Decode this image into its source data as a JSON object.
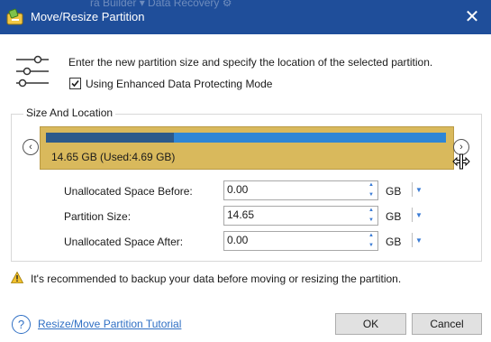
{
  "window": {
    "title": "Move/Resize Partition",
    "background_title": "ra Builder  ▾  Data Recovery  ⚙",
    "close_icon": "close-icon",
    "app_icon": "partition-tool-icon",
    "title_bar_color": "#1f4e9a"
  },
  "intro": {
    "icon": "sliders-icon",
    "text": "Enter the new partition size and specify the location of the selected partition.",
    "checkbox_label": "Using Enhanced Data Protecting Mode",
    "checkbox_checked": true
  },
  "size_and_location": {
    "title": "Size And Location",
    "partition_label": "14.65 GB (Used:4.69 GB)",
    "used_fraction": 0.32,
    "block_color": "#d9b95c",
    "used_color": "#2d5a8a",
    "free_color": "#2e86d6",
    "left_arrow_icon": "chevron-left-icon",
    "right_arrow_icon": "chevron-right-icon",
    "resize_cursor_icon": "resize-cursor-icon"
  },
  "fields": [
    {
      "label": "Unallocated Space Before:",
      "value": "0.00",
      "unit": "GB"
    },
    {
      "label": "Partition Size:",
      "value": "14.65",
      "unit": "GB"
    },
    {
      "label": "Unallocated Space After:",
      "value": "0.00",
      "unit": "GB"
    }
  ],
  "warning": {
    "icon": "warning-icon",
    "text": "It's recommended to backup your data before moving or resizing the partition."
  },
  "footer": {
    "help_icon": "help-icon",
    "help_glyph": "?",
    "tutorial_link": "Resize/Move Partition Tutorial",
    "ok_label": "OK",
    "cancel_label": "Cancel"
  }
}
